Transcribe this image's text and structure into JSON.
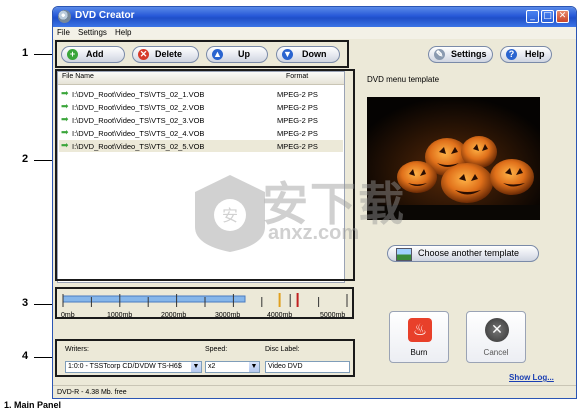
{
  "window": {
    "title": "DVD Creator"
  },
  "menu": {
    "items": [
      "File",
      "Settings",
      "Help"
    ]
  },
  "toolbar": {
    "add": "Add",
    "delete": "Delete",
    "up": "Up",
    "down": "Down",
    "settings": "Settings",
    "help": "Help"
  },
  "filelist": {
    "col_name": "File Name",
    "col_format": "Format",
    "rows": [
      {
        "path": "I:\\DVD_Root\\Video_TS\\VTS_02_1.VOB",
        "format": "MPEG-2 PS"
      },
      {
        "path": "I:\\DVD_Root\\Video_TS\\VTS_02_2.VOB",
        "format": "MPEG-2 PS"
      },
      {
        "path": "I:\\DVD_Root\\Video_TS\\VTS_02_3.VOB",
        "format": "MPEG-2 PS"
      },
      {
        "path": "I:\\DVD_Root\\Video_TS\\VTS_02_4.VOB",
        "format": "MPEG-2 PS"
      },
      {
        "path": "I:\\DVD_Root\\Video_TS\\VTS_02_5.VOB",
        "format": "MPEG-2 PS"
      }
    ]
  },
  "template": {
    "label": "DVD menu template",
    "choose": "Choose another template"
  },
  "capacity": {
    "labels": [
      "0mb",
      "1000mb",
      "2000mb",
      "3000mb",
      "4000mb",
      "5000mb"
    ],
    "used_fraction": 0.64
  },
  "actions": {
    "burn": "Burn",
    "cancel": "Cancel"
  },
  "writer": {
    "writers_label": "Writers:",
    "writers_value": "1:0:0 - TSSTcorp CD/DVDW TS-H6$",
    "speed_label": "Speed:",
    "speed_value": "x2",
    "disc_label": "Disc Label:",
    "disc_value": "Video DVD"
  },
  "status": {
    "text": "DVD-R - 4.38 Mb. free",
    "show_log": "Show Log..."
  },
  "callouts": [
    "1",
    "2",
    "3",
    "4"
  ],
  "footnote": "1. Main Panel",
  "watermark": {
    "text": "安下载",
    "sub": "anxz.com"
  }
}
